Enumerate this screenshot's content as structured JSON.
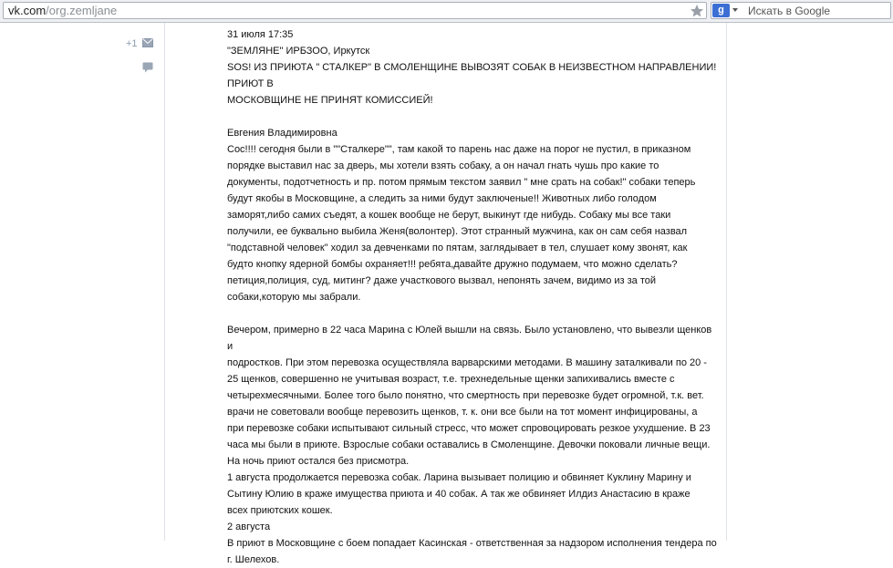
{
  "browser": {
    "url_host": "vk.com",
    "url_path": "/org.zemljane",
    "search_placeholder": "Искать в Google",
    "search_engine_badge": "g"
  },
  "sidebar": {
    "like_count": "+1"
  },
  "post": {
    "timestamp": "31 июля 17:35",
    "source": "\"ЗЕМЛЯНЕ\" ИРБЗОО, Иркутск",
    "headline_1": "SOS! ИЗ ПРИЮТА \" СТАЛКЕР\" В СМОЛЕНЩИНЕ ВЫВОЗЯТ СОБАК В НЕИЗВЕСТНОМ НАПРАВЛЕНИИ! ПРИЮТ В",
    "headline_2": "МОСКОВЩИНЕ НЕ ПРИНЯТ КОМИССИЕЙ!",
    "author": "Евгения Владимировна",
    "quote_lines": [
      "Сос!!!! сегодня были в \"\"Сталкере\"\", там какой то парень нас даже на порог не пустил, в приказном",
      "порядке выставил нас за дверь, мы хотели взять собаку, а он начал гнать чушь про какие то",
      "документы, подотчетность и пр. потом прямым текстом заявил \" мне срать на собак!\" собаки теперь",
      "будут якобы в Московщине, а следить за ними будут заключеные!! Животных либо голодом",
      "заморят,либо самих съедят, а кошек вообще не берут, выкинут где нибудь. Собаку мы все таки",
      "получили, ее буквально выбила Женя(волонтер). Этот странный мужчина, как он сам себя назвал",
      "\"подставной человек\" ходил за девченками по пятам, заглядывает в тел, слушает кому звонят, как",
      "будто кнопку ядерной бомбы охраняет!!! ребята,давайте дружно подумаем, что можно сделать?",
      "петиция,полиция, суд, митинг? даже участкового вызвал, непонять зачем, видимо из за той",
      "собаки,которую мы забрали."
    ],
    "evening_lines": [
      "Вечером, примерно в 22 часа Марина с Юлей вышли на связь. Было установлено, что вывезли щенков и",
      "подростков. При этом перевозка осуществляла варварскими методами. В машину заталкивали по 20 -",
      "25 щенков, совершенно не учитывая возраст, т.е. трехнедельные щенки запихивались вместе с",
      "четырехмесячными. Более того было понятно, что смертность при перевозке будет огромной, т.к. вет.",
      "врачи не советовали вообще перевозить щенков, т. к. они все были на тот момент инфицированы, а",
      "при перевозке собаки испытывают сильный стресс, что может спровоцировать резкое ухудшение. В 23",
      "часа мы были в приюте. Взрослые собаки оставались в Смоленщине. Девочки поковали личные вещи.",
      "На ночь приют остался без присмотра."
    ],
    "aug1_lines": [
      "1 августа продолжается перевозка собак. Ларина вызывает полицию и обвиняет Куклину Марину и",
      "Сытину Юлию в краже имущества приюта и 40 собак. А так же обвиняет Илдиз Анастасию в краже",
      "всех приютских кошек."
    ],
    "aug2_label": "2 августа",
    "aug2_lines": [
      "В приют в Московщине с боем попадает Касинская - ответственная за надзором исполнения тендера по",
      "г. Шелехов."
    ]
  }
}
